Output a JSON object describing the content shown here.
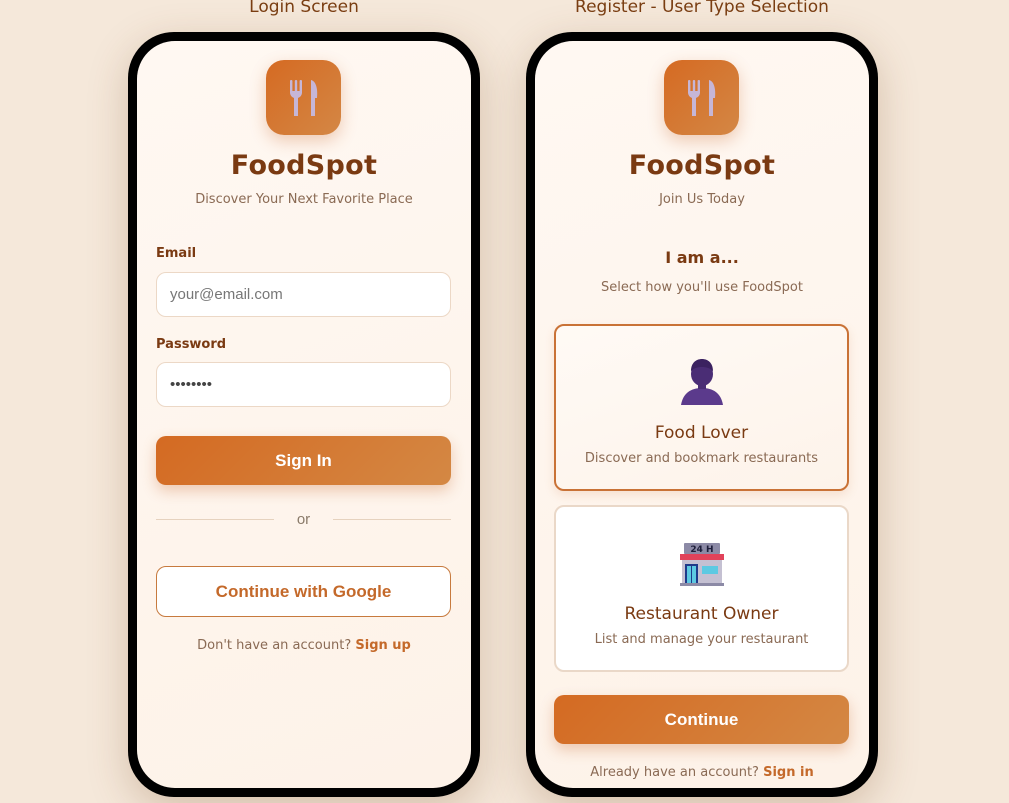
{
  "captions": {
    "login": "Login Screen",
    "register": "Register - User Type Selection"
  },
  "app": {
    "name": "FoodSpot",
    "logo_icon": "fork-knife-icon"
  },
  "login": {
    "tagline": "Discover Your Next Favorite Place",
    "email_label": "Email",
    "email_placeholder": "your@email.com",
    "password_label": "Password",
    "password_value": "••••••••",
    "sign_in_label": "Sign In",
    "divider_text": "or",
    "google_label": "Continue with Google",
    "footer_text": "Don't have an account?",
    "footer_link": "Sign up"
  },
  "register": {
    "tagline": "Join Us Today",
    "heading": "I am a...",
    "subheading": "Select how you'll use FoodSpot",
    "options": [
      {
        "title": "Food Lover",
        "description": "Discover and bookmark restaurants",
        "icon": "person-icon",
        "selected": true
      },
      {
        "title": "Restaurant Owner",
        "description": "List and manage your restaurant",
        "icon": "store-24h-icon",
        "icon_sign": "24 H",
        "selected": false
      }
    ],
    "continue_label": "Continue",
    "footer_text": "Already have an account?",
    "footer_link": "Sign in"
  },
  "colors": {
    "background": "#f5e8da",
    "brand": "#7a3a12",
    "accent": "#d46a22",
    "accent_text": "#c4692a"
  }
}
